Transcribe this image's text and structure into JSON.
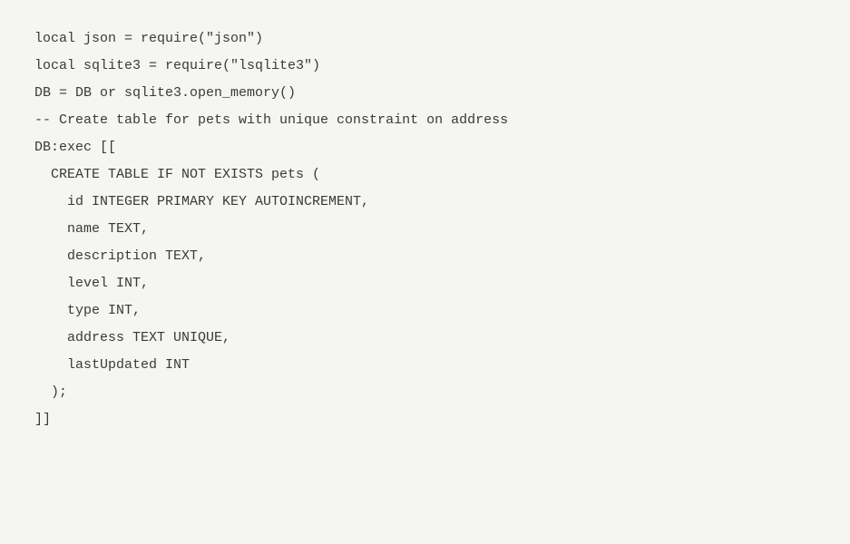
{
  "code": {
    "lines": [
      "local json = require(\"json\")",
      "local sqlite3 = require(\"lsqlite3\")",
      "",
      "DB = DB or sqlite3.open_memory()",
      "",
      "-- Create table for pets with unique constraint on address",
      "DB:exec [[",
      "  CREATE TABLE IF NOT EXISTS pets (",
      "    id INTEGER PRIMARY KEY AUTOINCREMENT,",
      "    name TEXT,",
      "    description TEXT,",
      "    level INT,",
      "    type INT,",
      "    address TEXT UNIQUE,",
      "    lastUpdated INT",
      "  );",
      "]]"
    ]
  }
}
